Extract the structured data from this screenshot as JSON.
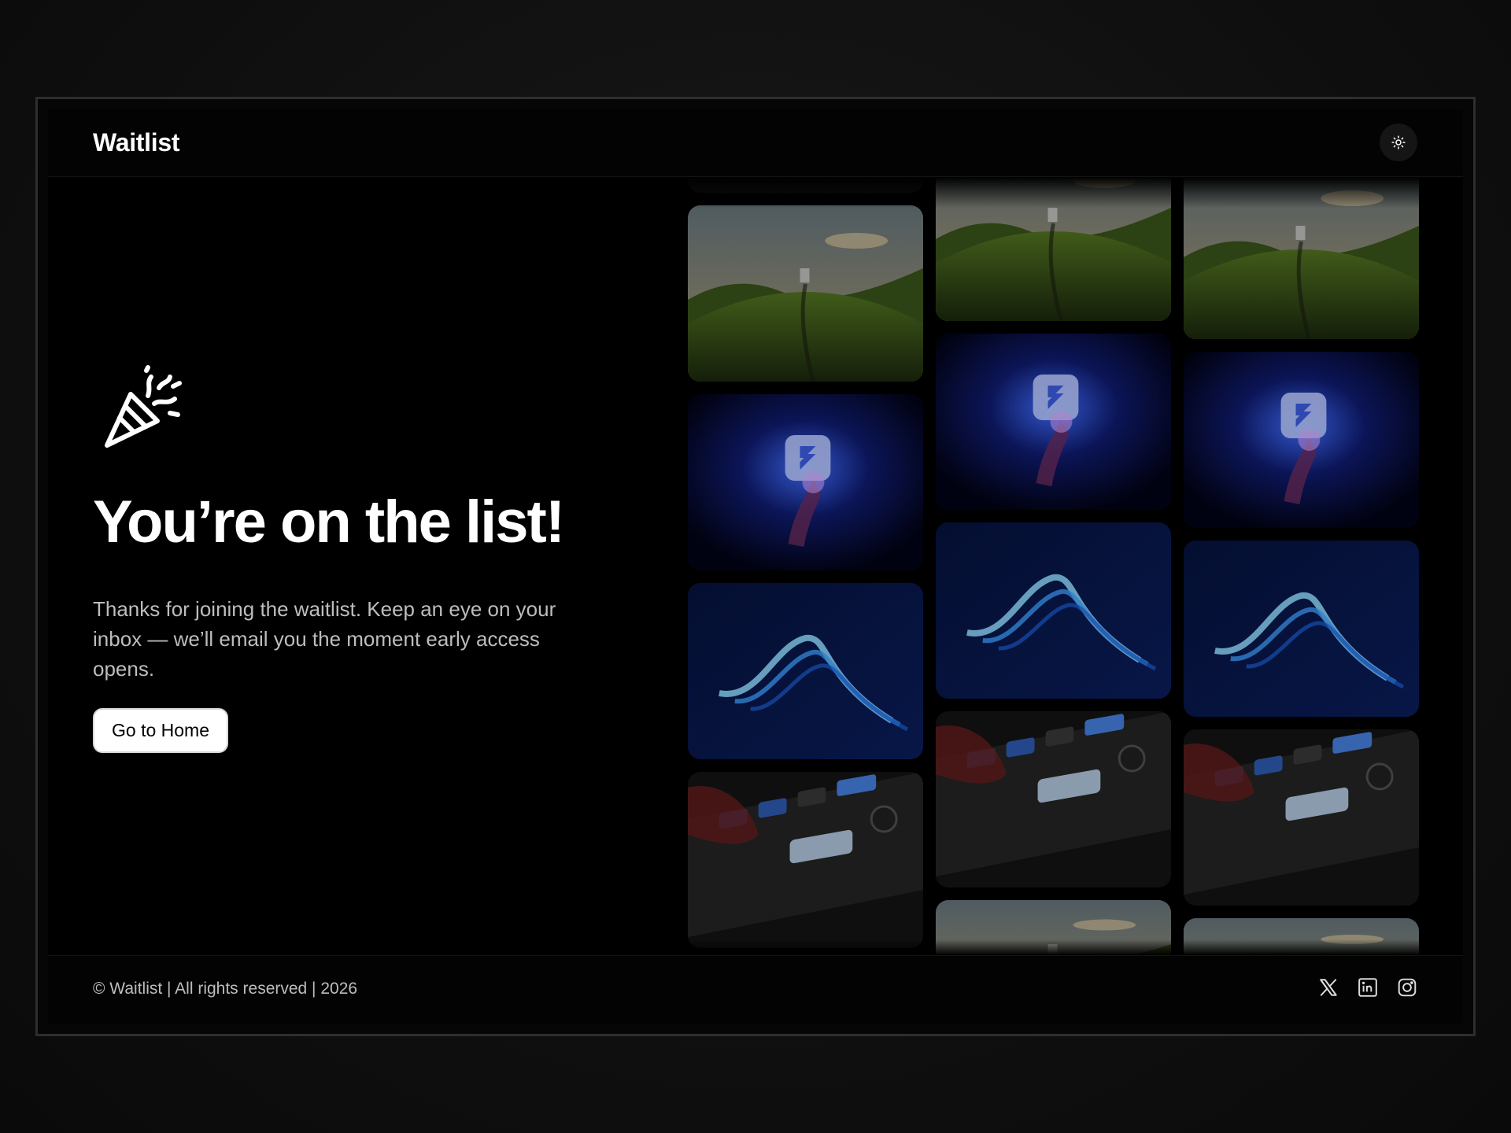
{
  "header": {
    "brand": "Waitlist",
    "theme_toggle_icon": "sun-icon"
  },
  "hero": {
    "icon": "party-popper-icon",
    "headline": "You’re on the list!",
    "description": "Thanks for joining the waitlist. Keep an eye on your inbox — we’ll email you the moment early access opens.",
    "cta_label": "Go to Home"
  },
  "gallery": {
    "columns": [
      [
        "hills",
        "glow-hand",
        "waves",
        "keyboard"
      ],
      [
        "hills",
        "glow-hand",
        "waves",
        "keyboard"
      ],
      [
        "hills",
        "glow-hand",
        "waves",
        "keyboard"
      ]
    ]
  },
  "footer": {
    "copyright": "© Waitlist | All rights reserved | 2026",
    "socials": [
      "x-icon",
      "linkedin-icon",
      "instagram-icon"
    ]
  },
  "colors": {
    "background": "#000000",
    "text": "#ffffff",
    "muted_text": "#bdbdbd",
    "accent_blue": "#3b7dff"
  }
}
